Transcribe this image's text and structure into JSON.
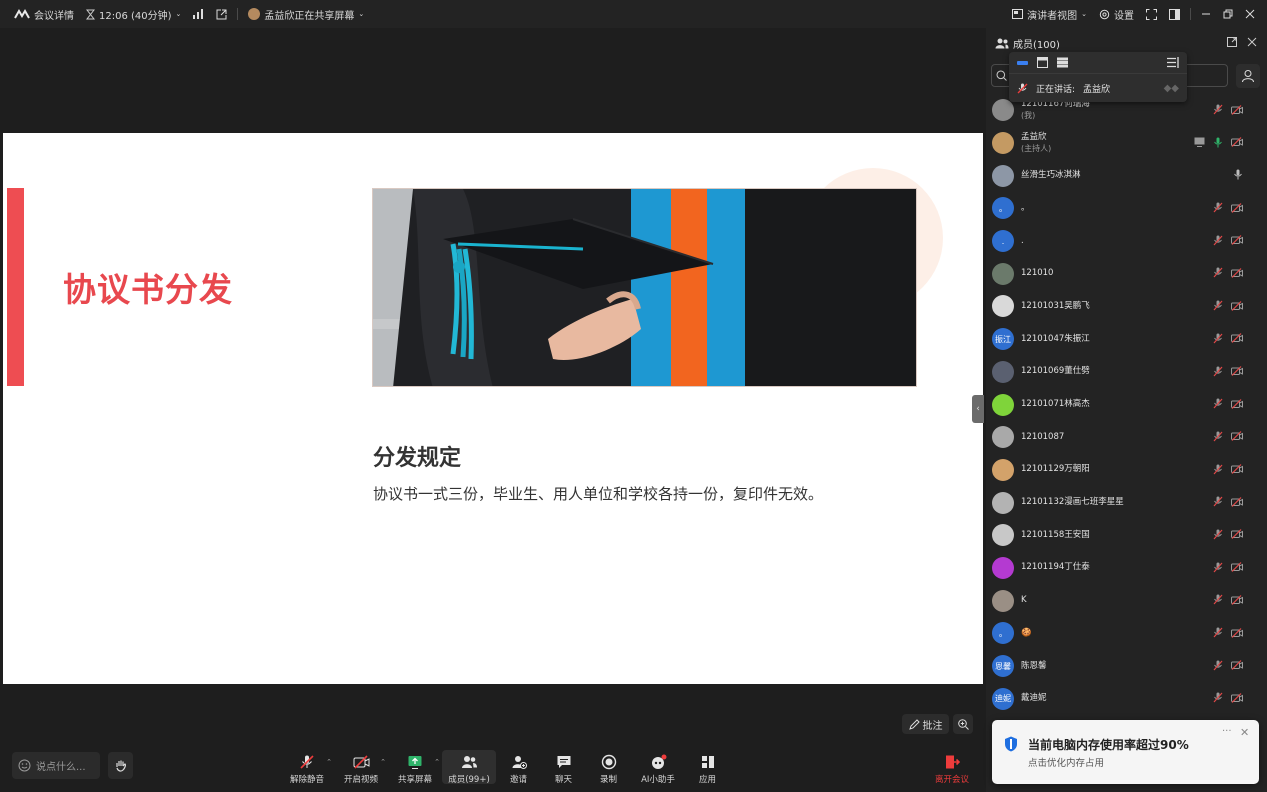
{
  "topbar": {
    "meeting_details": "会议详情",
    "timer": "12:06 (40分钟)",
    "sharing_status": "孟益欣正在共享屏幕",
    "presenter_view": "演讲者视图",
    "settings": "设置"
  },
  "slide": {
    "title": "协议书分发",
    "subtitle": "分发规定",
    "body": "协议书一式三份，毕业生、用人单位和学校各持一份，复印件无效。"
  },
  "stage": {
    "annotate_label": "批注"
  },
  "bottombar": {
    "chat_placeholder": "说点什么...",
    "tools": [
      {
        "label": "解除静音"
      },
      {
        "label": "开启视频"
      },
      {
        "label": "共享屏幕"
      },
      {
        "label": "成员(99+)"
      },
      {
        "label": "邀请"
      },
      {
        "label": "聊天"
      },
      {
        "label": "录制"
      },
      {
        "label": "AI小助手"
      },
      {
        "label": "应用"
      }
    ],
    "leave_label": "离开会议"
  },
  "panel": {
    "title": "成员(100)",
    "speaking_label": "正在讲话:",
    "speaking_name": "孟益欣",
    "members": [
      {
        "name": "12101167何瑞海",
        "role": "(我)",
        "avatar_color": "#8a8a8a",
        "avatar_text": ""
      },
      {
        "name": "孟益欣",
        "role": "(主持人)",
        "avatar_color": "#c49a63",
        "avatar_text": ""
      },
      {
        "name": "丝滑生巧冰淇淋",
        "role": "",
        "avatar_color": "#8d97a6",
        "avatar_text": ""
      },
      {
        "name": "。",
        "role": "",
        "avatar_color": "#2f6fd0",
        "avatar_text": "。"
      },
      {
        "name": ".",
        "role": "",
        "avatar_color": "#2f6fd0",
        "avatar_text": "."
      },
      {
        "name": "121010",
        "role": "",
        "avatar_color": "#6b7a6b",
        "avatar_text": ""
      },
      {
        "name": "12101031吴鹏飞",
        "role": "",
        "avatar_color": "#d9d9d9",
        "avatar_text": ""
      },
      {
        "name": "12101047朱振江",
        "role": "",
        "avatar_color": "#2f6fd0",
        "avatar_text": "振江"
      },
      {
        "name": "12101069董仕劈",
        "role": "",
        "avatar_color": "#5a6070",
        "avatar_text": ""
      },
      {
        "name": "12101071林高杰",
        "role": "",
        "avatar_color": "#7fd43a",
        "avatar_text": ""
      },
      {
        "name": "12101087",
        "role": "",
        "avatar_color": "#a9a9a9",
        "avatar_text": ""
      },
      {
        "name": "12101129万朝阳",
        "role": "",
        "avatar_color": "#d3a26a",
        "avatar_text": ""
      },
      {
        "name": "12101132漫画七班李星星",
        "role": "",
        "avatar_color": "#b3b3b3",
        "avatar_text": ""
      },
      {
        "name": "12101158王安国",
        "role": "",
        "avatar_color": "#c8c8c8",
        "avatar_text": ""
      },
      {
        "name": "12101194丁仕泰",
        "role": "",
        "avatar_color": "#b43ad1",
        "avatar_text": ""
      },
      {
        "name": "K",
        "role": "",
        "avatar_color": "#9a8f85",
        "avatar_text": ""
      },
      {
        "name": "🍪",
        "role": "",
        "avatar_color": "#2f6fd0",
        "avatar_text": "。"
      },
      {
        "name": "陈恩馨",
        "role": "",
        "avatar_color": "#2f6fd0",
        "avatar_text": "恩馨"
      },
      {
        "name": "戴迪妮",
        "role": "",
        "avatar_color": "#2f6fd0",
        "avatar_text": "迪妮"
      }
    ]
  },
  "toast": {
    "title": "当前电脑内存使用率超过90%",
    "subtitle": "点击优化内存占用"
  }
}
